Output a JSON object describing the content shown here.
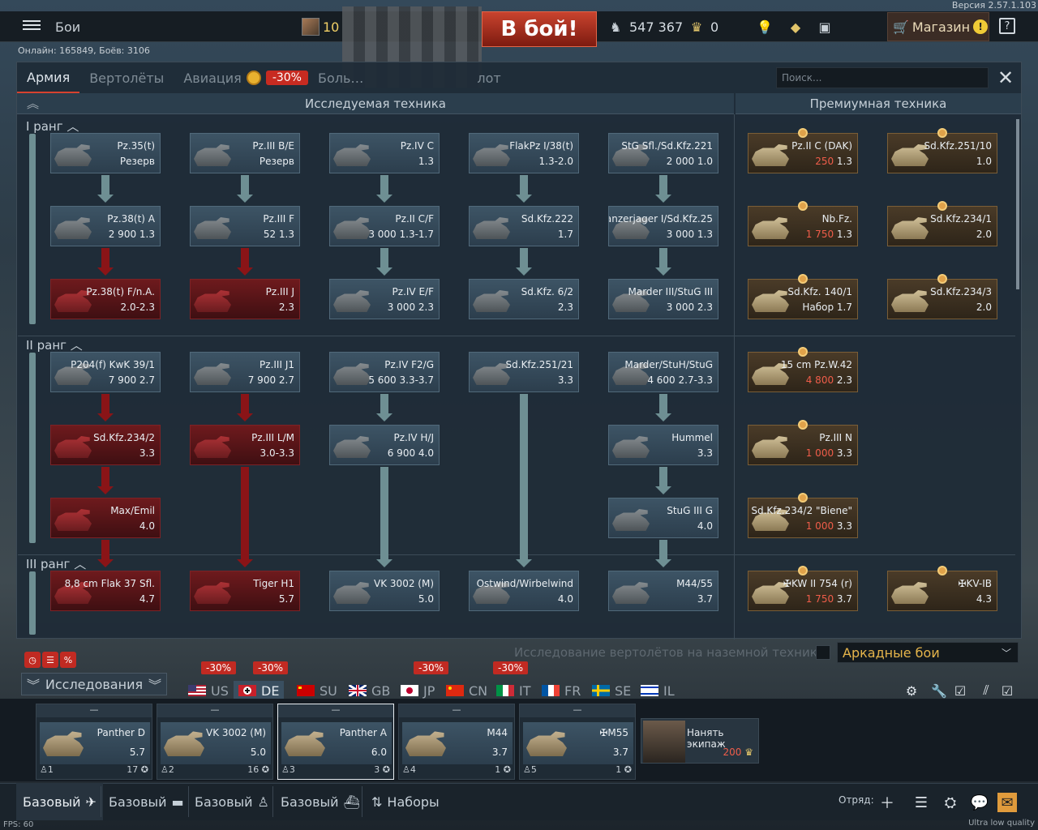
{
  "version": "Версия 2.57.1.103",
  "header": {
    "menu_label": "Бои",
    "online": "Онлайн: 165849, Боёв: 3106",
    "player_level": "10",
    "battle_button": "В бой!",
    "silver_lions": "547 367",
    "golden_eagles": "0",
    "shop_label": "Магазин",
    "shop_warning": "!",
    "help": "?"
  },
  "tabs": [
    {
      "label": "Армия",
      "active": true
    },
    {
      "label": "Вертолёты"
    },
    {
      "label": "Авиация"
    },
    {
      "label": "Боль…",
      "suffix": "лот"
    }
  ],
  "aviation_discount": "-30%",
  "search_placeholder": "Поиск...",
  "sections": {
    "researchable": "Исследуемая техника",
    "premium": "Премиумная техника"
  },
  "ranks": [
    "I ранг",
    "II ранг",
    "III ранг"
  ],
  "tree": {
    "col1": [
      {
        "name": "Pz.35(t)",
        "stat": "Резерв",
        "state": "owned"
      },
      {
        "name": "Pz.38(t) A",
        "rp": "2 900",
        "br": "1.3",
        "state": "owned"
      },
      {
        "name": "Pz.38(t) F/n.A.",
        "br": "2.0-2.3",
        "state": "locked"
      },
      {
        "name": "P204(f) KwK 39/1",
        "rp": "7 900",
        "br": "2.7",
        "state": "owned"
      },
      {
        "name": "Sd.Kfz.234/2",
        "br": "3.3",
        "state": "locked"
      },
      {
        "name": "Max/Emil",
        "br": "4.0",
        "state": "locked"
      },
      {
        "name": "8,8 cm Flak 37 Sfl.",
        "br": "4.7",
        "state": "locked"
      }
    ],
    "col2": [
      {
        "name": "Pz.III B/E",
        "stat": "Резерв",
        "state": "owned"
      },
      {
        "name": "Pz.III F",
        "rp": "52",
        "br": "1.3",
        "state": "owned"
      },
      {
        "name": "Pz.III J",
        "br": "2.3",
        "state": "locked"
      },
      {
        "name": "Pz.III J1",
        "rp": "7 900",
        "br": "2.7",
        "state": "owned"
      },
      {
        "name": "Pz.III L/M",
        "br": "3.0-3.3",
        "state": "locked"
      },
      {
        "name": "Tiger H1",
        "br": "5.7",
        "state": "locked"
      }
    ],
    "col3": [
      {
        "name": "Pz.IV C",
        "br": "1.3",
        "state": "owned"
      },
      {
        "name": "Pz.II C/F",
        "rp": "3 000",
        "br": "1.3-1.7",
        "state": "owned"
      },
      {
        "name": "Pz.IV E/F",
        "rp": "3 000",
        "br": "2.3",
        "state": "owned"
      },
      {
        "name": "Pz.IV F2/G",
        "rp": "5 600",
        "br": "3.3-3.7",
        "state": "owned"
      },
      {
        "name": "Pz.IV H/J",
        "rp": "6 900",
        "br": "4.0",
        "state": "owned"
      },
      {
        "name": "VK 3002 (M)",
        "br": "5.0",
        "state": "owned"
      }
    ],
    "col4": [
      {
        "name": "FlakPz I/38(t)",
        "br": "1.3-2.0",
        "state": "owned"
      },
      {
        "name": "Sd.Kfz.222",
        "br": "1.7",
        "state": "owned"
      },
      {
        "name": "Sd.Kfz. 6/2",
        "br": "2.3",
        "state": "owned"
      },
      {
        "name": "Sd.Kfz.251/21",
        "br": "3.3",
        "state": "owned"
      },
      {
        "name": "Ostwind/Wirbelwind",
        "br": "4.0",
        "state": "owned"
      }
    ],
    "col5": [
      {
        "name": "StG Sfl./Sd.Kfz.221",
        "rp": "2 000",
        "br": "1.0",
        "state": "owned"
      },
      {
        "name": "Panzerjager I/Sd.Kfz.25",
        "rp": "3 000",
        "br": "1.3",
        "state": "owned"
      },
      {
        "name": "Marder III/StuG III",
        "rp": "3 000",
        "br": "2.3",
        "state": "owned"
      },
      {
        "name": "Marder/StuH/StuG",
        "rp": "4 600",
        "br": "2.7-3.3",
        "state": "owned"
      },
      {
        "name": "Hummel",
        "br": "3.3",
        "state": "owned"
      },
      {
        "name": "StuG III G",
        "br": "4.0",
        "state": "owned"
      },
      {
        "name": "M44/55",
        "br": "3.7",
        "state": "owned"
      }
    ],
    "prem1": [
      {
        "name": "Pz.II C (DAK)",
        "rp": "250",
        "br": "1.3"
      },
      {
        "name": "Nb.Fz.",
        "rp": "1 750",
        "br": "1.3"
      },
      {
        "name": "Sd.Kfz. 140/1",
        "stat": "Набор",
        "br": "1.7"
      },
      {
        "name": "15 cm Pz.W.42",
        "rp": "4 800",
        "br": "2.3"
      },
      {
        "name": "Pz.III N",
        "rp": "1 000",
        "br": "3.3"
      },
      {
        "name": "Sd.Kfz.234/2 \"Biene\"",
        "rp": "1 000",
        "br": "3.3"
      },
      {
        "name": "✠KW II 754 (r)",
        "rp": "1 750",
        "br": "3.7"
      }
    ],
    "prem2": [
      {
        "name": "Sd.Kfz.251/10",
        "br": "1.0"
      },
      {
        "name": "Sd.Kfz.234/1",
        "br": "2.0"
      },
      {
        "name": "Sd.Kfz.234/3",
        "br": "2.0"
      },
      {
        "name": "✠KV-IB",
        "br": "4.3"
      }
    ]
  },
  "heli_research_label": "Исследование вертолётов на наземной технике",
  "game_mode": "Аркадные бои",
  "research_button": "Исследования",
  "nations": [
    {
      "code": "US"
    },
    {
      "code": "DE",
      "active": true
    },
    {
      "code": "SU"
    },
    {
      "code": "GB"
    },
    {
      "code": "JP"
    },
    {
      "code": "CN"
    },
    {
      "code": "IT"
    },
    {
      "code": "FR"
    },
    {
      "code": "SE"
    },
    {
      "code": "IL"
    }
  ],
  "discounts": {
    "us": "-30%",
    "de": "-30%",
    "jp": "-30%",
    "it": "-30%"
  },
  "slots": [
    {
      "top": "—",
      "name": "Panther D",
      "br": "5.7",
      "crew": "1",
      "level": "17"
    },
    {
      "top": "—",
      "name": "VK 3002 (M)",
      "br": "5.0",
      "crew": "2",
      "level": "16"
    },
    {
      "top": "—",
      "name": "Panther A",
      "br": "6.0",
      "crew": "3",
      "level": "3"
    },
    {
      "top": "—",
      "name": "M44",
      "br": "3.7",
      "crew": "4",
      "level": "1"
    },
    {
      "top": "—",
      "name": "✠M55",
      "br": "3.7",
      "crew": "5",
      "level": "1"
    }
  ],
  "hire_crew": {
    "label": "Нанять экипаж",
    "price": "200"
  },
  "bottom_nav": [
    {
      "label": "Базовый",
      "active": true
    },
    {
      "label": "Базовый"
    },
    {
      "label": "Базовый"
    },
    {
      "label": "Базовый"
    },
    {
      "label": "Наборы"
    }
  ],
  "squad_label": "Отряд:",
  "fps": "FPS: 60",
  "quality": "Ultra low quality"
}
